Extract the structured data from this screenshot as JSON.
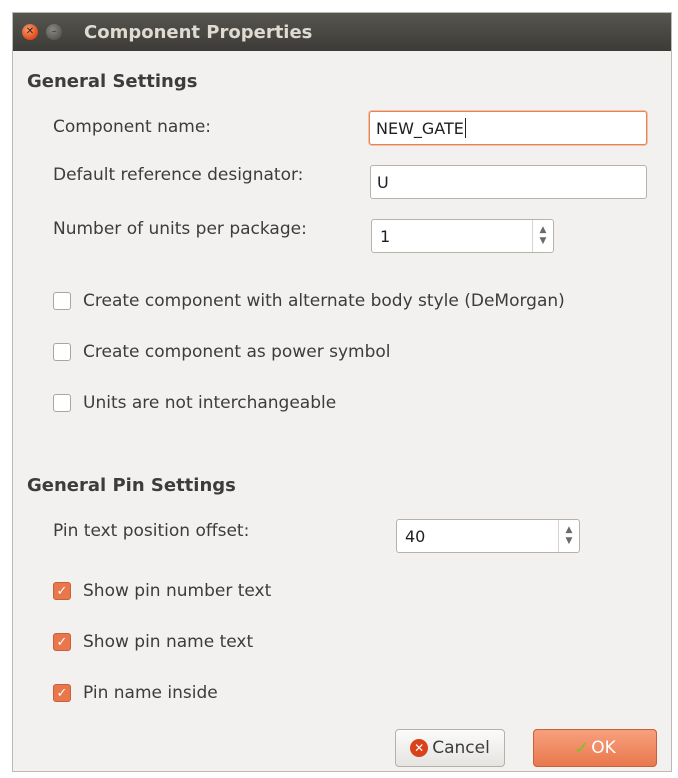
{
  "window": {
    "title": "Component Properties",
    "close_glyph": "✕",
    "minimize_glyph": "–"
  },
  "general": {
    "heading": "General Settings",
    "component_name": {
      "label": "Component name:",
      "value": "NEW_GATE"
    },
    "reference": {
      "label": "Default reference designator:",
      "value": "U"
    },
    "units": {
      "label": "Number of units per package:",
      "value": "1"
    },
    "checkboxes": [
      {
        "label": "Create component with alternate body style (DeMorgan)",
        "checked": false
      },
      {
        "label": "Create component as power symbol",
        "checked": false
      },
      {
        "label": "Units are not interchangeable",
        "checked": false
      }
    ]
  },
  "pins": {
    "heading": "General Pin Settings",
    "offset": {
      "label": "Pin text position offset:",
      "value": "40"
    },
    "checkboxes": [
      {
        "label": "Show pin number text",
        "checked": true
      },
      {
        "label": "Show pin name text",
        "checked": true
      },
      {
        "label": "Pin name inside",
        "checked": true
      }
    ]
  },
  "buttons": {
    "cancel": "Cancel",
    "ok": "OK"
  },
  "icons": {
    "close": "close-icon",
    "minimize": "minimize-icon",
    "spin_up": "chevron-up-icon",
    "spin_down": "chevron-down-icon",
    "cancel": "cancel-icon",
    "ok": "checkmark-icon"
  },
  "colors": {
    "accent": "#e8784c",
    "titlebar": "#3c3b37",
    "background": "#f2f1f0"
  }
}
